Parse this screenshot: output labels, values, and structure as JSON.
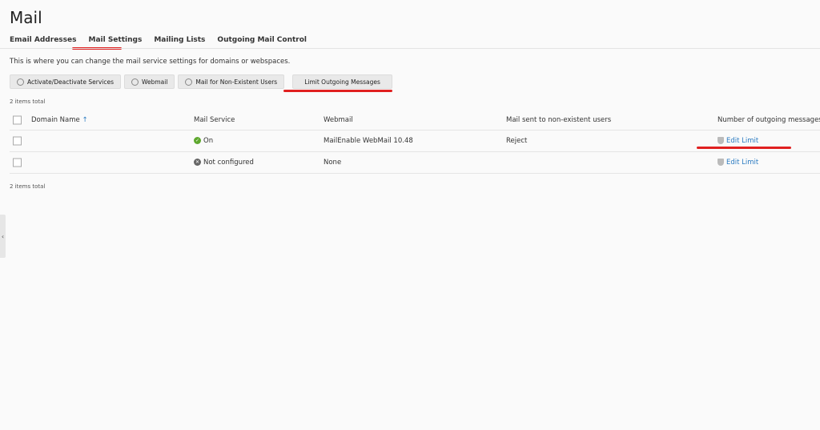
{
  "page": {
    "title": "Mail",
    "description": "This is where you can change the mail service settings for domains or webspaces."
  },
  "tabs": [
    "Email Addresses",
    "Mail Settings",
    "Mailing Lists",
    "Outgoing Mail Control"
  ],
  "toolbar": {
    "activate": "Activate/Deactivate Services",
    "webmail": "Webmail",
    "nonexistent": "Mail for Non-Existent Users",
    "limit": "Limit Outgoing Messages"
  },
  "table": {
    "count_top": "2 items total",
    "count_bottom": "2 items total",
    "headers": {
      "domain": "Domain Name",
      "sort_arrow": "↑",
      "mail_service": "Mail Service",
      "webmail": "Webmail",
      "nonexistent": "Mail sent to non-existent users",
      "outgoing": "Number of outgoing messages"
    },
    "rows": [
      {
        "domain": "",
        "mail_service": "On",
        "mail_status_glyph": "✓",
        "webmail": "MailEnable WebMail 10.48",
        "nonexistent": "Reject",
        "action": "Edit Limit"
      },
      {
        "domain": "",
        "mail_service": "Not configured",
        "mail_status_glyph": "✕",
        "webmail": "None",
        "nonexistent": "",
        "action": "Edit Limit"
      }
    ]
  },
  "sidebar_toggle": "‹",
  "colors": {
    "link": "#2b7bc1",
    "status_on": "#5ea82e",
    "highlight": "#e02020"
  }
}
